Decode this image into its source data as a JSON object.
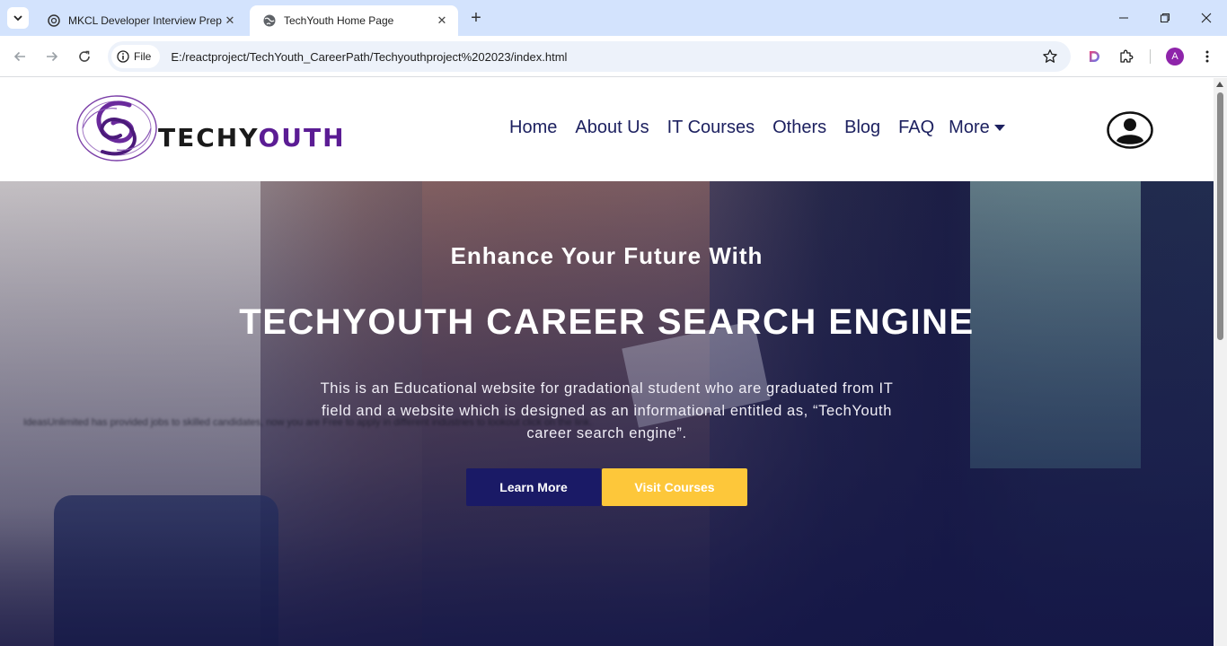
{
  "browser": {
    "tabs": [
      {
        "title": "MKCL Developer Interview Prep",
        "active": false
      },
      {
        "title": "TechYouth Home Page",
        "active": true
      }
    ],
    "address": {
      "chip": "File",
      "url": "E:/reactproject/TechYouth_CareerPath/Techyouthproject%202023/index.html"
    },
    "profile_initial": "A"
  },
  "site": {
    "logo": {
      "part1": "TECHY",
      "part2": "OUTH"
    },
    "nav": {
      "home": "Home",
      "about": "About Us",
      "courses": "IT Courses",
      "others": "Others",
      "blog": "Blog",
      "faq": "FAQ",
      "more": "More"
    }
  },
  "hero": {
    "subtitle": "Enhance Your Future With",
    "title": "TECHYOUTH CAREER SEARCH ENGINE",
    "description": "This is an Educational website for gradational student who are graduated from IT field and a website which is designed as an informational entitled as, “TechYouth career search engine”.",
    "ticker": "IdeasUnlimited has provided jobs to skilled candidates, now you are Free to apply in different industries to lookout click on the link.",
    "buttons": {
      "learn_more": "Learn More",
      "visit_courses": "Visit Courses"
    }
  },
  "colors": {
    "nav_text": "#1d2160",
    "learn_button": "#1a1a66",
    "visit_button": "#fdc73a",
    "logo_purple": "#5b1c94",
    "tabstrip": "#d3e3fd"
  }
}
